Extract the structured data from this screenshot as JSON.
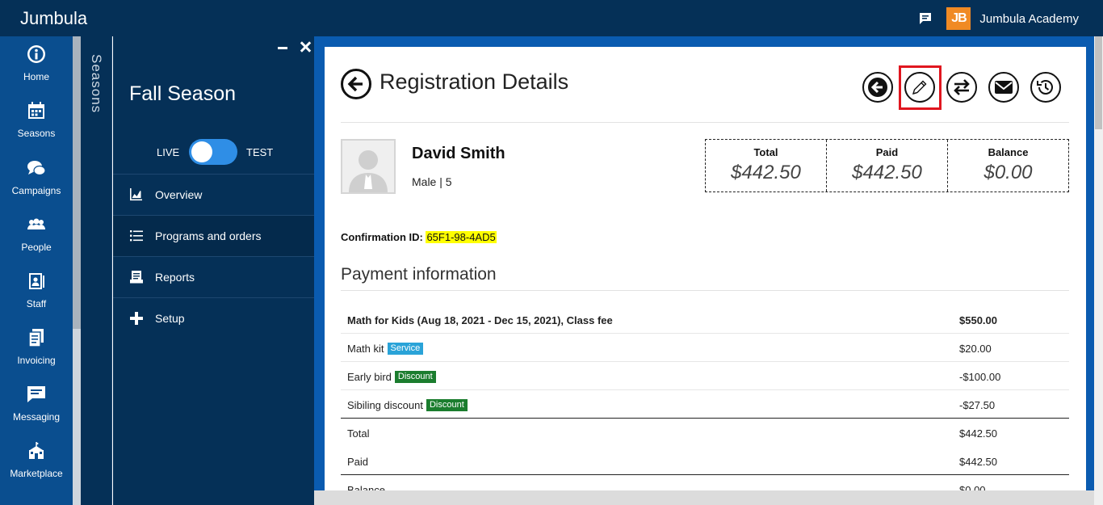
{
  "topbar": {
    "brand": "Jumbula",
    "org_logo_text": "JB",
    "org_name": "Jumbula Academy",
    "org_logo_color": "#f08a24"
  },
  "leftnav": {
    "items": [
      {
        "label": "Home",
        "icon": "info-icon"
      },
      {
        "label": "Seasons",
        "icon": "calendar-icon"
      },
      {
        "label": "Campaigns",
        "icon": "chat-bubbles-icon"
      },
      {
        "label": "People",
        "icon": "people-icon"
      },
      {
        "label": "Staff",
        "icon": "staff-badge-icon"
      },
      {
        "label": "Invoicing",
        "icon": "invoice-icon"
      },
      {
        "label": "Messaging",
        "icon": "message-icon"
      },
      {
        "label": "Marketplace",
        "icon": "school-icon"
      }
    ]
  },
  "seasons_strip": {
    "label": "Seasons"
  },
  "season_panel": {
    "title": "Fall Season",
    "toggle_live": "LIVE",
    "toggle_test": "TEST",
    "menu": [
      {
        "label": "Overview",
        "icon": "chart-icon"
      },
      {
        "label": "Programs and orders",
        "icon": "list-icon"
      },
      {
        "label": "Reports",
        "icon": "report-icon"
      },
      {
        "label": "Setup",
        "icon": "plus-icon"
      }
    ]
  },
  "main": {
    "title": "Registration Details",
    "actions": [
      "back-icon",
      "edit-icon",
      "transfer-icon",
      "email-icon",
      "history-icon"
    ],
    "person": {
      "name": "David Smith",
      "sub": "Male | 5"
    },
    "summary": {
      "total_label": "Total",
      "total_value": "$442.50",
      "paid_label": "Paid",
      "paid_value": "$442.50",
      "balance_label": "Balance",
      "balance_value": "$0.00"
    },
    "confirmation": {
      "label": "Confirmation ID:",
      "value": "65F1-98-4AD5"
    },
    "payment_title": "Payment information",
    "payment_rows": [
      {
        "desc": "Math for Kids (Aug 18, 2021 - Dec 15, 2021), Class fee",
        "badge": "",
        "amount": "$550.00"
      },
      {
        "desc": "Math kit",
        "badge": "Service",
        "amount": "$20.00"
      },
      {
        "desc": "Early bird",
        "badge": "Discount",
        "amount": "-$100.00"
      },
      {
        "desc": "Sibiling discount",
        "badge": "Discount",
        "amount": "-$27.50"
      },
      {
        "desc": "Total",
        "badge": "",
        "amount": "$442.50"
      },
      {
        "desc": "Paid",
        "badge": "",
        "amount": "$442.50"
      },
      {
        "desc": "Balance",
        "badge": "",
        "amount": "$0.00"
      }
    ]
  }
}
